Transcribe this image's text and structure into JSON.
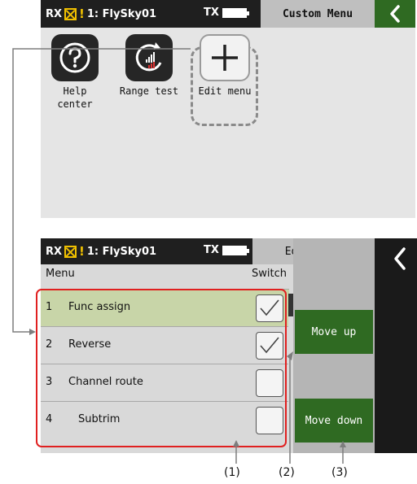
{
  "colors": {
    "accent_green": "#2f6a22",
    "highlight_row": "#c8d5a8",
    "annotation_red": "#e02020"
  },
  "screen1": {
    "status": {
      "rx": "RX",
      "model": "1: FlySky01",
      "tx": "TX"
    },
    "title": "Custom Menu",
    "back_icon": "chevron-left-icon",
    "tiles": [
      {
        "label_line1": "Help",
        "label_line2": "center",
        "icon": "question-circle-icon"
      },
      {
        "label_line1": "Range test",
        "label_line2": "",
        "icon": "range-signal-icon"
      },
      {
        "label_line1": "Edit menu",
        "label_line2": "",
        "icon": "plus-icon"
      }
    ]
  },
  "screen2": {
    "status": {
      "rx": "RX",
      "model": "1: FlySky01",
      "tx": "TX"
    },
    "title": "Edit menu",
    "back_icon": "chevron-left-icon",
    "header": {
      "menu": "Menu",
      "switch": "Switch"
    },
    "rows": [
      {
        "num": "1",
        "name": "Func assign",
        "checked": true,
        "selected": true
      },
      {
        "num": "2",
        "name": "Reverse",
        "checked": true,
        "selected": false
      },
      {
        "num": "3",
        "name": "Channel route",
        "checked": false,
        "selected": false
      },
      {
        "num": "4",
        "name": "Subtrim",
        "checked": false,
        "selected": false
      }
    ],
    "buttons": {
      "move_up": "Move up",
      "move_down": "Move down"
    }
  },
  "annotations": {
    "a1": "(1)",
    "a2": "(2)",
    "a3": "(3)"
  }
}
